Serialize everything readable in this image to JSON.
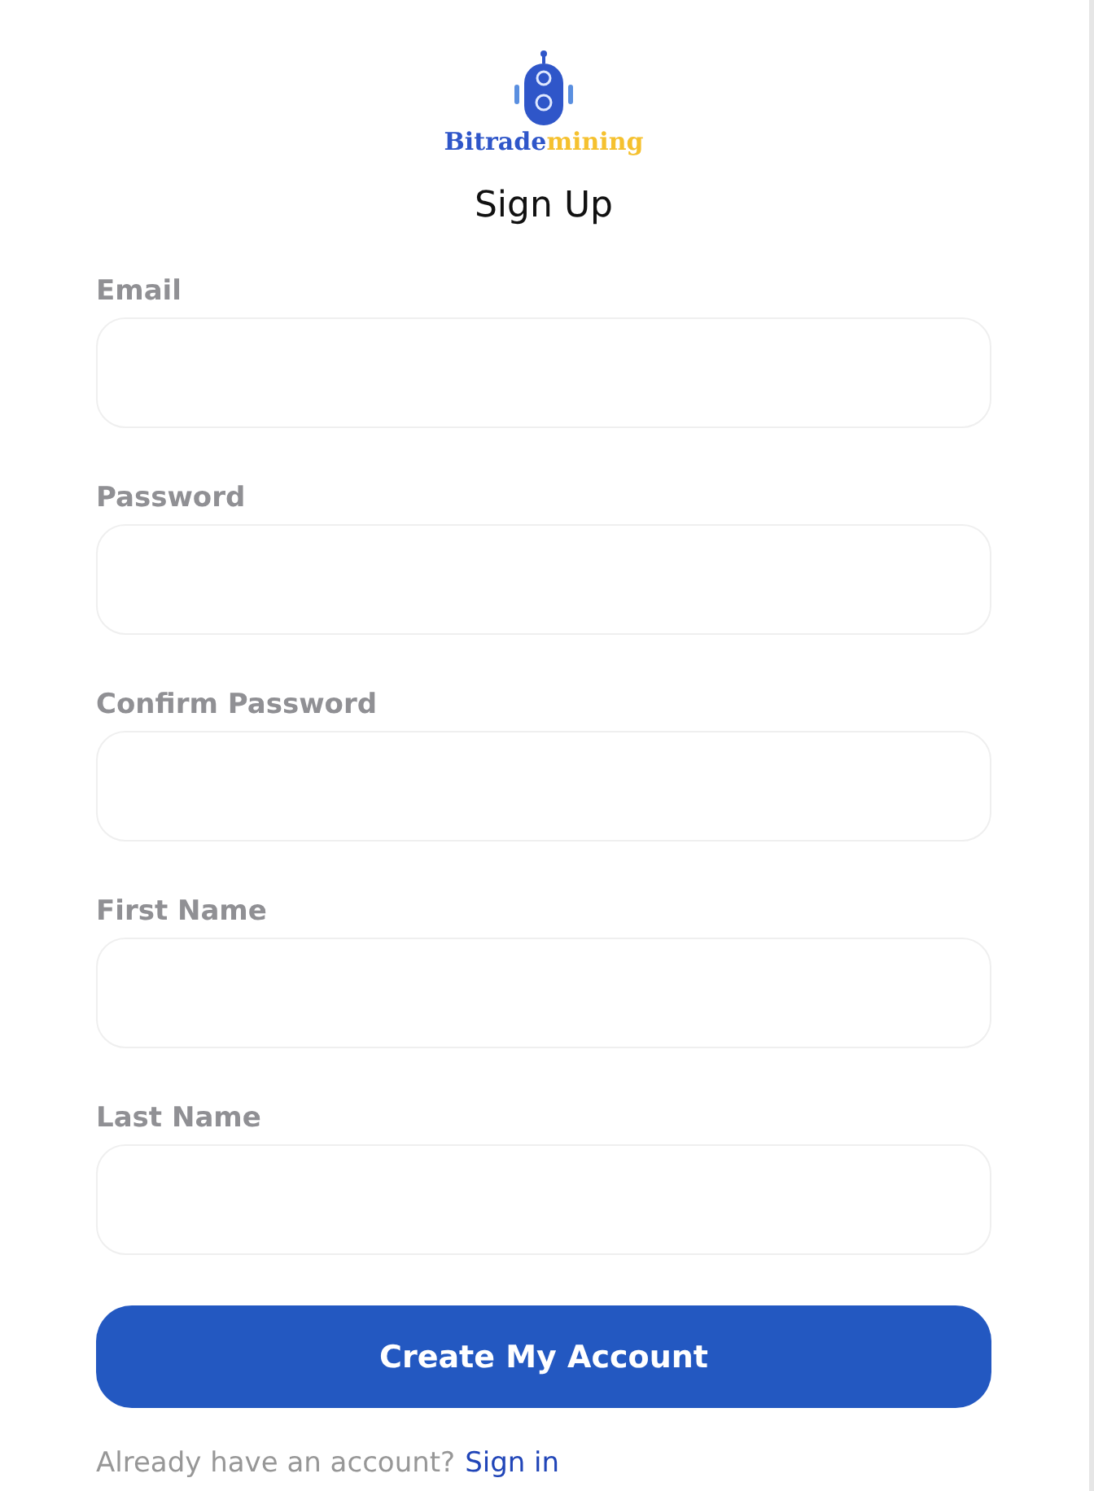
{
  "logo": {
    "name_part_1": "Bitrade",
    "name_part_2": "mining"
  },
  "title": "Sign Up",
  "fields": [
    {
      "label": "Email"
    },
    {
      "label": "Password"
    },
    {
      "label": "Confirm Password"
    },
    {
      "label": "First Name"
    },
    {
      "label": "Last Name"
    }
  ],
  "submit_button": "Create My Account",
  "footer": {
    "text": "Already have an account?",
    "link": "Sign in"
  }
}
